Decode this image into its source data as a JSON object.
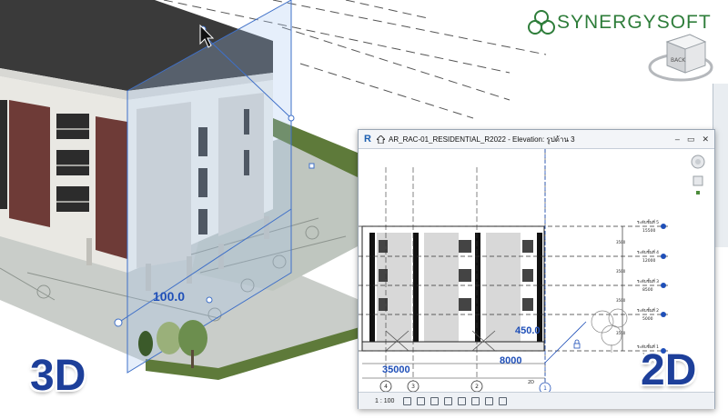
{
  "logo": {
    "text": "SYNERGYSOFT"
  },
  "labels": {
    "left": "3D",
    "right": "2D"
  },
  "viewcube": {
    "face_label": "BACK"
  },
  "model3d": {
    "dimension": "100.0"
  },
  "window": {
    "title": "AR_RAC-01_RESIDENTIAL_R2022 - Elevation: รูปด้าน 3",
    "min": "–",
    "max": "▭",
    "close": "✕"
  },
  "elevation": {
    "dim_height": "450.0",
    "dim_total": "35000",
    "dim_span": "8000",
    "grid_bubbles": [
      "4",
      "3",
      "2",
      "1"
    ],
    "levels": [
      "ระดับชั้นที่ 5",
      "ระดับชั้นที่ 4",
      "ระดับชั้นที่ 3",
      "ระดับชั้นที่ 2",
      "ระดับชั้นที่ 1"
    ],
    "level_values": [
      "15500",
      "12000",
      "8500",
      "5000",
      "1500"
    ],
    "side_dims": [
      "3500",
      "3500",
      "3500",
      "3500"
    ],
    "grid_label": "2D"
  },
  "status": {
    "scale": "1 : 100"
  },
  "colors": {
    "accent": "#1d3f9a",
    "logo": "#2e7d3a",
    "dim": "#1f4fb8"
  },
  "icons": [
    "cursor-icon",
    "viewcube-icon",
    "revit-logo-icon",
    "home-icon",
    "navigation-wheel-icon",
    "zoom-icon"
  ]
}
